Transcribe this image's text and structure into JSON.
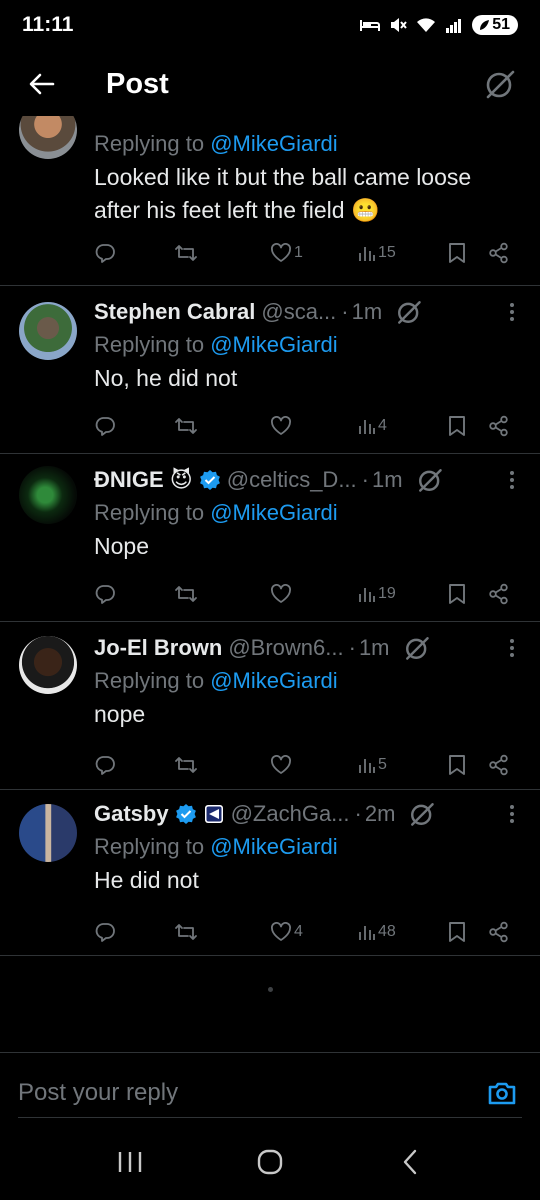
{
  "status_bar": {
    "time": "11:11",
    "battery": "51"
  },
  "header": {
    "title": "Post"
  },
  "replies": [
    {
      "display_name": "",
      "handle": "",
      "time": "",
      "replying_prefix": "Replying to",
      "replying_to": "@MikeGiardi",
      "text": "Looked like it but the ball came loose after his feet left the field 😬",
      "likes": "1",
      "views": "15"
    },
    {
      "display_name": "Stephen Cabral",
      "handle": "@sca...",
      "time": "1m",
      "replying_prefix": "Replying to",
      "replying_to": "@MikeGiardi",
      "text": "No, he did not",
      "likes": "",
      "views": "4"
    },
    {
      "display_name": "ÐNIGE 😈",
      "handle": "@celtics_D...",
      "time": "1m",
      "replying_prefix": "Replying to",
      "replying_to": "@MikeGiardi",
      "text": "Nope",
      "likes": "",
      "views": "19"
    },
    {
      "display_name": "Jo-El Brown",
      "handle": "@Brown6...",
      "time": "1m",
      "replying_prefix": "Replying to",
      "replying_to": "@MikeGiardi",
      "text": "nope",
      "likes": "",
      "views": "5"
    },
    {
      "display_name": "Gatsby",
      "handle": "@ZachGa...",
      "time": "2m",
      "replying_prefix": "Replying to",
      "replying_to": "@MikeGiardi",
      "text": "He did not",
      "likes": "4",
      "views": "48"
    }
  ],
  "composer": {
    "placeholder": "Post your reply"
  },
  "colors": {
    "accent": "#1d9bf0",
    "muted": "#71767b",
    "background": "#000000",
    "text": "#e7e9ea",
    "divider": "#2f3336"
  }
}
